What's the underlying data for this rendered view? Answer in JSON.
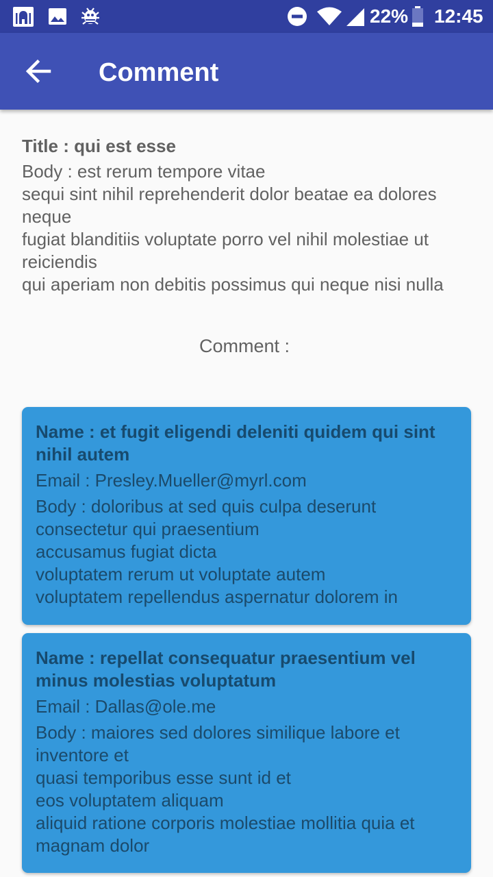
{
  "status_bar": {
    "battery": "22%",
    "time": "12:45",
    "left_icons": [
      "mosque-icon",
      "image-icon",
      "bug-icon"
    ],
    "right_icons": [
      "do-not-disturb-icon",
      "wifi-icon",
      "signal-icon",
      "battery-icon"
    ]
  },
  "app_bar": {
    "title": "Comment",
    "back_icon": "arrow-back-icon",
    "color": "#3f51b5"
  },
  "post": {
    "title": "Title : qui est esse",
    "body": "Body  : est rerum tempore vitae\nsequi sint nihil reprehenderit dolor beatae ea dolores neque\nfugiat blanditiis voluptate porro vel nihil molestiae ut reiciendis\nqui aperiam non debitis possimus qui neque nisi nulla"
  },
  "comment_label": "Comment :",
  "comments": [
    {
      "name": "Name : et fugit eligendi deleniti quidem qui sint nihil autem",
      "email": "Email : Presley.Mueller@myrl.com",
      "body": "Body : doloribus at sed quis culpa deserunt consectetur qui praesentium\naccusamus fugiat dicta\nvoluptatem rerum ut voluptate autem\nvoluptatem repellendus aspernatur dolorem in"
    },
    {
      "name": "Name : repellat consequatur praesentium vel minus molestias voluptatum",
      "email": "Email : Dallas@ole.me",
      "body": "Body : maiores sed dolores similique labore et inventore et\nquasi temporibus esse sunt id et\neos voluptatem aliquam\naliquid ratione corporis molestiae mollitia quia et magnam dolor"
    }
  ],
  "card_color": "#3498db"
}
